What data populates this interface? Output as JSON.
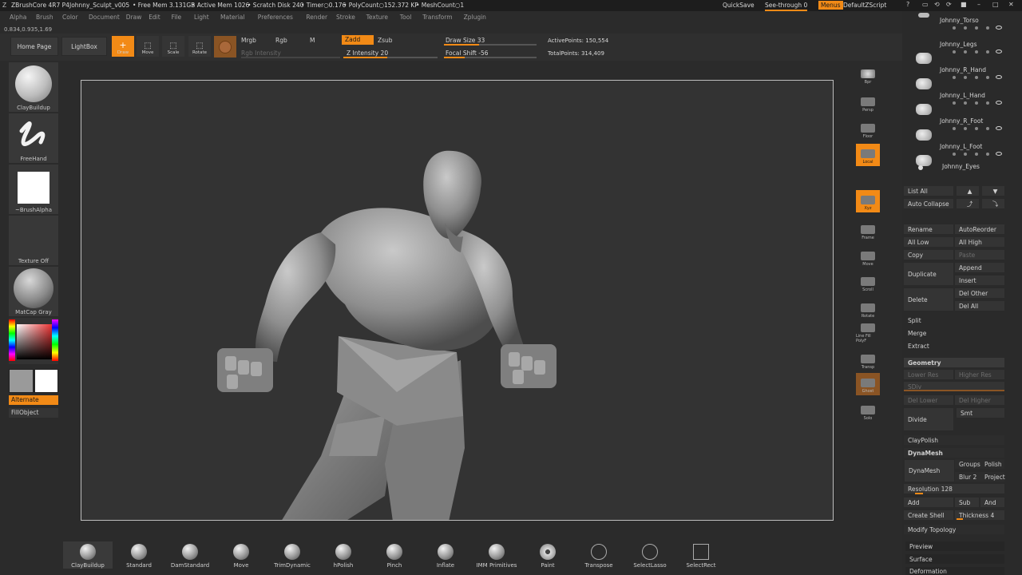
{
  "titlebar": {
    "app": "ZBrushCore 4R7 P4",
    "document": "Johnny_Sculpt_v005",
    "free_mem": "• Free Mem 3.131GB",
    "active_mem": "• Active Mem 1026",
    "scratch": "• Scratch Disk 240",
    "timer": "• Timer○0.176",
    "polycount": "• PolyCount○152.372 KP",
    "meshcount": "• MeshCount○1",
    "quicksave": "QuickSave",
    "see_through": "See-through  0",
    "menus": "Menus",
    "default_script": "DefaultZScript"
  },
  "menubar": [
    "Alpha",
    "Brush",
    "Color",
    "Document",
    "Draw",
    "Edit",
    "File",
    "Light",
    "Material",
    "Preferences",
    "Render",
    "Stroke",
    "Texture",
    "Tool",
    "Transform",
    "Zplugin"
  ],
  "coords": "0.834,0.935,1.69",
  "shelf": {
    "home_page": "Home Page",
    "lightbox": "LightBox",
    "draw": "Draw",
    "move": "Move",
    "scale": "Scale",
    "rotate": "Rotate",
    "mrgb": "Mrgb",
    "rgb": "Rgb",
    "m": "M",
    "rgb_intensity": "Rgb Intensity",
    "zadd": "Zadd",
    "zsub": "Zsub",
    "z_intensity": "Z Intensity 20",
    "draw_size": "Draw Size 33",
    "focal_shift": "Focal Shift -56",
    "active_points": "ActivePoints: 150,554",
    "total_points": "TotalPoints: 314,409"
  },
  "left_tray": {
    "brush": "ClayBuildup",
    "stroke": "FreeHand",
    "alpha": "~BrushAlpha",
    "texture": "Texture Off",
    "material": "MatCap Gray",
    "alternate": "Alternate",
    "fill_object": "FillObject"
  },
  "dock": [
    "Bpr",
    "Persp",
    "Floor",
    "Local",
    "Xyz",
    "Frame",
    "Move",
    "Scroll",
    "Rotate",
    "Line Fill PolyF",
    "Transp",
    "Ghost",
    "Solo"
  ],
  "subtools": [
    "Johnny_Torso",
    "Johnny_Legs",
    "Johnny_R_Hand",
    "Johnny_L_Hand",
    "Johnny_R_Foot",
    "Johnny_L_Foot",
    "Johnny_Eyes"
  ],
  "panel": {
    "list_all": "List All",
    "auto_collapse": "Auto Collapse",
    "rename": "Rename",
    "auto_reorder": "AutoReorder",
    "all_low": "All Low",
    "all_high": "All High",
    "copy": "Copy",
    "paste": "Paste",
    "duplicate": "Duplicate",
    "append": "Append",
    "insert": "Insert",
    "delete": "Delete",
    "del_other": "Del Other",
    "del_all": "Del All",
    "split": "Split",
    "merge": "Merge",
    "extract": "Extract",
    "geometry": "Geometry",
    "lower_res": "Lower Res",
    "higher_res": "Higher Res",
    "sdiv": "SDiv",
    "del_lower": "Del Lower",
    "del_higher": "Del Higher",
    "divide": "Divide",
    "smt": "Smt",
    "claypolish": "ClayPolish",
    "dynamesh_header": "DynaMesh",
    "dynamesh_btn": "DynaMesh",
    "groups": "Groups",
    "polish": "Polish",
    "blur": "Blur 2",
    "project": "Project",
    "resolution": "Resolution 128",
    "add": "Add",
    "sub": "Sub",
    "and": "And",
    "create_shell": "Create Shell",
    "thickness": "Thickness 4",
    "modify_topology": "Modify Topology",
    "preview": "Preview",
    "surface": "Surface",
    "deformation": "Deformation"
  },
  "bottom_brushes": [
    "ClayBuildup",
    "Standard",
    "DamStandard",
    "Move",
    "TrimDynamic",
    "hPolish",
    "Pinch",
    "Inflate",
    "IMM Primitives",
    "Paint",
    "Transpose",
    "SelectLasso",
    "SelectRect"
  ],
  "colors": {
    "accent": "#f28a16",
    "background": "#2b2b2b",
    "canvas": "#333333"
  }
}
